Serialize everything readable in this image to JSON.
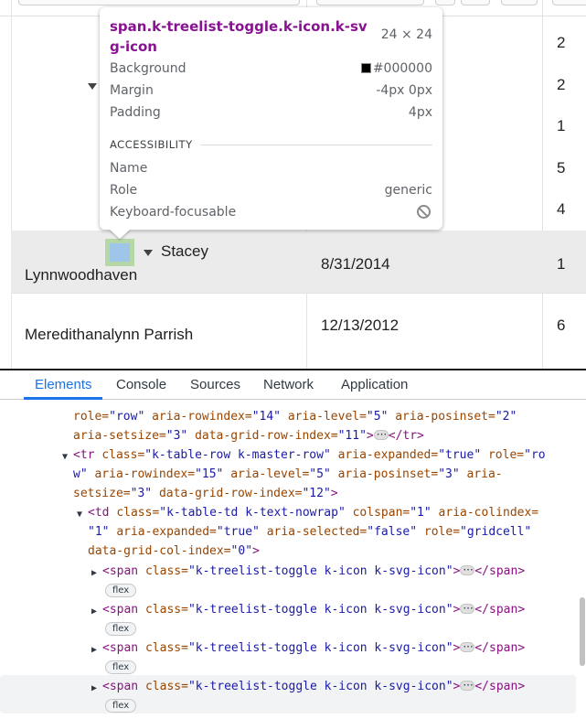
{
  "grid": {
    "rows": [
      {
        "number": "2"
      },
      {
        "number": "2"
      },
      {
        "number": "1"
      },
      {
        "number": "5"
      },
      {
        "number": "4"
      },
      {
        "name_line1": "Stacey",
        "name_line2": "Lynnwoodhaven",
        "date": "8/31/2014",
        "number": "1"
      },
      {
        "name": "Meredithanalynn Parrish",
        "date": "12/13/2012",
        "number": "6"
      }
    ]
  },
  "tooltip": {
    "selector": "span.k-treelist-toggle.k-icon.k-svg-icon",
    "size": "24 × 24",
    "background_label": "Background",
    "background_value": "#000000",
    "margin_label": "Margin",
    "margin_value": "-4px 0px",
    "padding_label": "Padding",
    "padding_value": "4px",
    "section_title": "ACCESSIBILITY",
    "name_label": "Name",
    "role_label": "Role",
    "role_value": "generic",
    "keyboard_label": "Keyboard-focusable",
    "keyboard_icon": "not-allowed-icon"
  },
  "devtools": {
    "tabs": [
      "Elements",
      "Console",
      "Sources",
      "Network",
      "Application"
    ],
    "active_tab": "Elements",
    "lines": {
      "l1_a": "role=",
      "l1_b": "\"row\"",
      "l1_c": "aria-rowindex=",
      "l1_d": "\"14\"",
      "l1_e": "aria-level=",
      "l1_f": "\"5\"",
      "l1_g": "aria-posinset=",
      "l1_h": "\"2\"",
      "l2_a": "aria-setsize=",
      "l2_b": "\"3\"",
      "l2_c": "data-grid-row-index=",
      "l2_d": "\"11\"",
      "l2_e": "</tr>",
      "l3_tag": "<tr",
      "l3_a": "class=",
      "l3_b": "\"k-table-row k-master-row\"",
      "l3_c": "aria-expanded=",
      "l3_d": "\"true\"",
      "l3_e": "role=",
      "l3_f": "\"ro",
      "l4_a": "w\"",
      "l4_b": "aria-rowindex=",
      "l4_c": "\"15\"",
      "l4_d": "aria-level=",
      "l4_e": "\"5\"",
      "l4_f": "aria-posinset=",
      "l4_g": "\"3\"",
      "l4_h": "aria-",
      "l5_a": "setsize=",
      "l5_b": "\"3\"",
      "l5_c": "data-grid-row-index=",
      "l5_d": "\"12\"",
      "l5_e": ">",
      "l6_tag": "<td",
      "l6_a": "class=",
      "l6_b": "\"k-table-td k-text-nowrap\"",
      "l6_c": "colspan=",
      "l6_d": "\"1\"",
      "l6_e": "aria-colindex=",
      "l7_a": "\"1\"",
      "l7_b": "aria-expanded=",
      "l7_c": "\"true\"",
      "l7_d": "aria-selected=",
      "l7_e": "\"false\"",
      "l7_f": "role=",
      "l7_g": "\"gridcell\"",
      "l8_a": "data-grid-col-index=",
      "l8_b": "\"0\"",
      "l8_c": ">",
      "span_open": "<span",
      "span_class_attr": "class=",
      "span_class_val": "\"k-treelist-toggle k-icon k-svg-icon\"",
      "span_gt": ">",
      "span_close": "</span>",
      "badge": "flex"
    }
  }
}
